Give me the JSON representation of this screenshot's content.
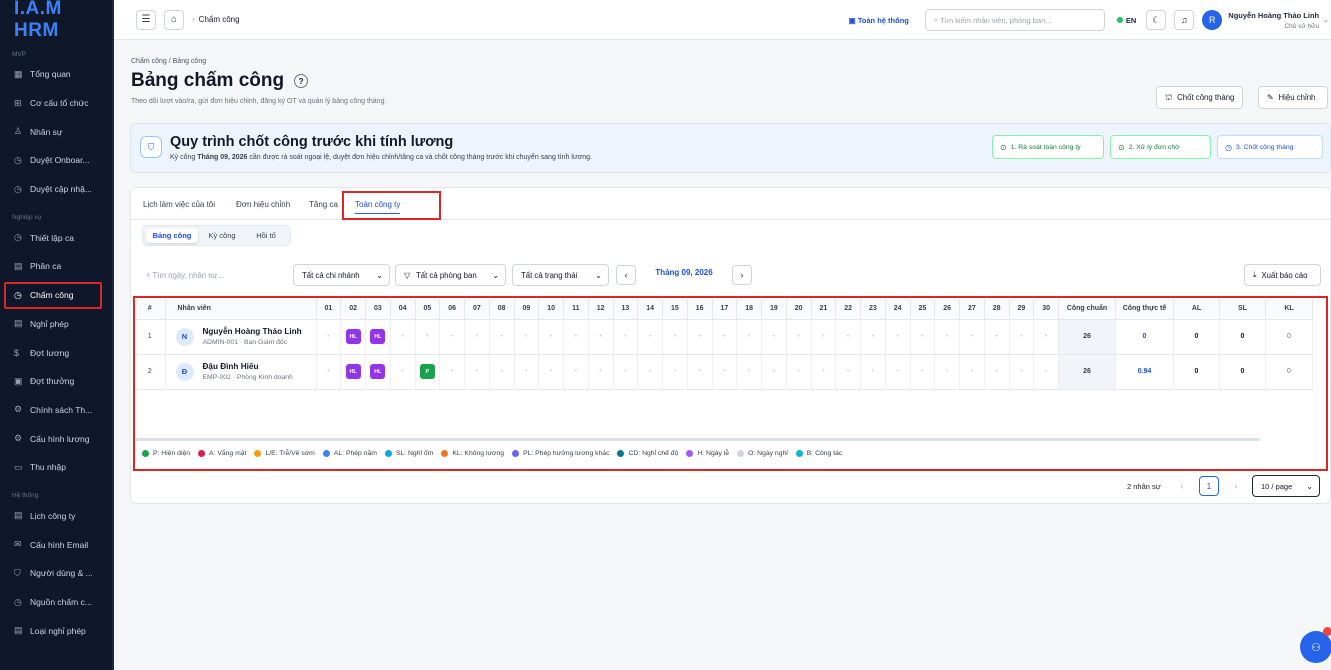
{
  "app": {
    "logo": "I.A.M HRM"
  },
  "sidebar": {
    "sections": [
      {
        "label": "MVP",
        "items": [
          {
            "icon": "▦",
            "name": "Tổng quan"
          },
          {
            "icon": "⊞",
            "name": "Cơ cấu tổ chức"
          },
          {
            "icon": "♙",
            "name": "Nhân sự"
          },
          {
            "icon": "◷",
            "name": "Duyệt Onboar..."
          },
          {
            "icon": "◷",
            "name": "Duyệt cập nhậ..."
          }
        ]
      },
      {
        "label": "Nghiệp vụ",
        "items": [
          {
            "icon": "◷",
            "name": "Thiết lập ca"
          },
          {
            "icon": "▤",
            "name": "Phân ca"
          },
          {
            "icon": "◷",
            "name": "Chấm công",
            "active": true
          },
          {
            "icon": "▤",
            "name": "Nghỉ phép"
          },
          {
            "icon": "$",
            "name": "Đợt lương"
          },
          {
            "icon": "▣",
            "name": "Đợt thưởng"
          },
          {
            "icon": "⚙",
            "name": "Chính sách Th..."
          },
          {
            "icon": "⚙",
            "name": "Cấu hình lương"
          },
          {
            "icon": "▭",
            "name": "Thu nhập"
          }
        ]
      },
      {
        "label": "Hệ thống",
        "items": [
          {
            "icon": "▤",
            "name": "Lịch công ty"
          },
          {
            "icon": "✉",
            "name": "Cấu hình Email"
          },
          {
            "icon": "⛉",
            "name": "Người dùng & ..."
          },
          {
            "icon": "◷",
            "name": "Nguồn chấm c..."
          },
          {
            "icon": "▤",
            "name": "Loại nghỉ phép"
          }
        ]
      }
    ]
  },
  "topbar": {
    "breadcrumb": "Chấm công",
    "org_label": "Toàn hệ thống",
    "search_placeholder": "Tìm kiếm nhân viên, phòng ban...",
    "lang": "EN",
    "user_name": "Nguyễn Hoàng Thảo Linh",
    "user_role": "Chủ sở hữu",
    "avatar_initial": "R"
  },
  "page": {
    "breadcrumb": "Chấm công / Bảng công",
    "title": "Bảng chấm công",
    "subtitle": "Theo dõi lượt vào/ra, gửi đơn hiệu chỉnh, đăng ký OT và quản lý bảng công tháng.",
    "btn_close_month": "Chốt công tháng",
    "btn_adjust": "Hiệu chỉnh"
  },
  "banner": {
    "title": "Quy trình chốt công trước khi tính lương",
    "desc_prefix": "Kỳ công ",
    "desc_period": "Tháng 09, 2026",
    "desc_suffix": " cần được rà soát ngoại lệ, duyệt đơn hiệu chỉnh/tăng ca và chốt công tháng trước khi chuyển sang tính lương.",
    "steps": [
      "1. Rà soát toàn công ty",
      "2. Xử lý đơn chờ",
      "3. Chốt công tháng"
    ]
  },
  "tabs": [
    "Lịch làm việc của tôi",
    "Đơn hiệu chỉnh",
    "Tăng ca",
    "Toàn công ty"
  ],
  "subtabs": [
    "Bảng công",
    "Kỳ công",
    "Hồi tố"
  ],
  "filters": {
    "search_placeholder": "Tìm ngày, nhân sự...",
    "branch": "Tất cả chi nhánh",
    "department": "Tất cả phòng ban",
    "status": "Tất cả trạng thái",
    "month": "Tháng 09, 2026",
    "export": "Xuất báo cáo"
  },
  "grid": {
    "col_index": "#",
    "col_employee": "Nhân viên",
    "days": [
      "01",
      "02",
      "03",
      "04",
      "05",
      "06",
      "07",
      "08",
      "09",
      "10",
      "11",
      "12",
      "13",
      "14",
      "15",
      "16",
      "17",
      "18",
      "19",
      "20",
      "21",
      "22",
      "23",
      "24",
      "25",
      "26",
      "27",
      "28",
      "29",
      "30"
    ],
    "summary_cols": [
      "Công chuẩn",
      "Công thực tế",
      "AL",
      "SL",
      "KL"
    ],
    "rows": [
      {
        "idx": "1",
        "initial": "N",
        "name": "Nguyễn Hoàng Thảo Linh",
        "sub": "ADMIN-001 · Ban Giám đốc",
        "marks": {
          "02": "HL",
          "03": "HL"
        },
        "standard": "26",
        "actual": "0",
        "al": "0",
        "sl": "0",
        "kl": "0"
      },
      {
        "idx": "2",
        "initial": "Đ",
        "name": "Đậu Đình Hiếu",
        "sub": "EMP-002 · Phòng Kinh doanh",
        "marks": {
          "02": "HL",
          "03": "HL",
          "05": "P"
        },
        "standard": "26",
        "actual": "0.94",
        "al": "0",
        "sl": "0",
        "kl": "0"
      }
    ],
    "empty_mark": "•"
  },
  "legend": [
    {
      "color": "#16a34a",
      "label": "P: Hiện diện"
    },
    {
      "color": "#e11d48",
      "label": "A: Vắng mặt"
    },
    {
      "color": "#f59e0b",
      "label": "L/E: Trễ/Về sớm"
    },
    {
      "color": "#3b82f6",
      "label": "AL: Phép năm"
    },
    {
      "color": "#0ea5e9",
      "label": "SL: Nghỉ ốm"
    },
    {
      "color": "#f97316",
      "label": "KL: Không lương"
    },
    {
      "color": "#6366f1",
      "label": "PL: Phép hưởng lương khác"
    },
    {
      "color": "#0e7490",
      "label": "CD: Nghỉ chế độ"
    },
    {
      "color": "#a855f7",
      "label": "H: Ngày lễ"
    },
    {
      "color": "#cbd5e1",
      "label": "O: Ngày nghỉ"
    },
    {
      "color": "#06b6d4",
      "label": "B: Công tác"
    }
  ],
  "mark_colors": {
    "HL": "#9333ea",
    "P": "#16a34a"
  },
  "pagination": {
    "count": "2 nhân sự",
    "current": "1",
    "page_size": "10 / page"
  }
}
